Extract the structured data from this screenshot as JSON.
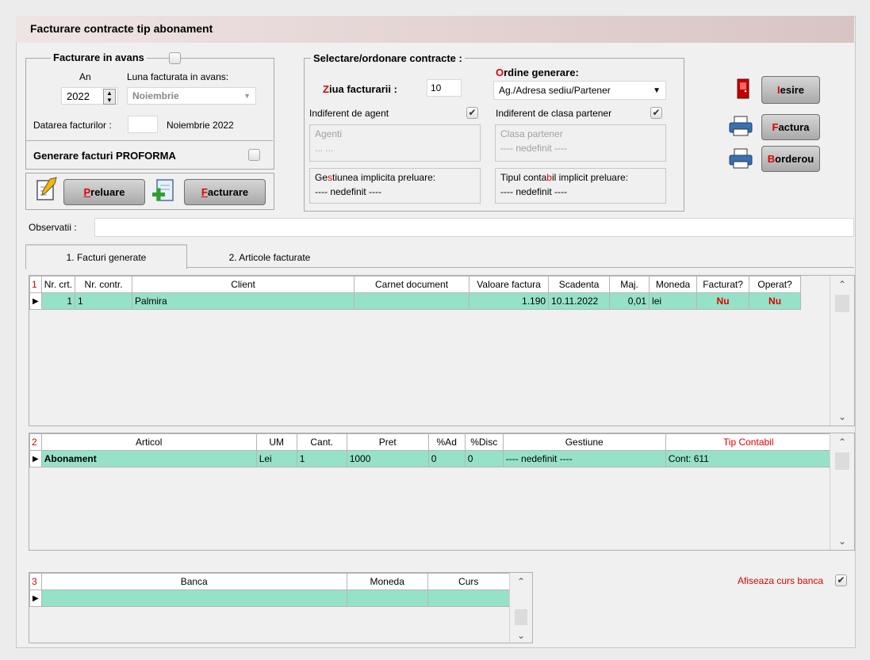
{
  "window": {
    "title": "Facturare contracte tip abonament"
  },
  "avans": {
    "group_label": "Facturare in avans",
    "an_label": "An",
    "an_value": "2022",
    "luna_label": "Luna facturata in avans:",
    "luna_value": "Noiembrie",
    "datarea_label": "Datarea facturilor :",
    "datarea_value": "Noiembrie 2022",
    "proforma_label": "Generare facturi PROFORMA"
  },
  "actions": {
    "preluare_first": "P",
    "preluare_rest": "reluare",
    "facturare_first": "F",
    "facturare_rest": "acturare"
  },
  "selectare": {
    "group_label": "Selectare/ordonare contracte :",
    "ziua_first": "Z",
    "ziua_rest": "iua facturarii :",
    "ziua_value": "10",
    "ordine_first": "O",
    "ordine_rest": "rdine generare:",
    "ordine_value": "Ag./Adresa sediu/Partener",
    "indif_agent": "Indiferent de agent",
    "indif_clasa": "Indiferent de clasa partener",
    "agenti_label": "Agenti",
    "agenti_value": "... ...",
    "clasa_label": "Clasa partener",
    "clasa_value": "---- nedefinit ----",
    "gest_label_pre": "Ge",
    "gest_label_s": "s",
    "gest_label_post": "tiunea implicita preluare:",
    "gest_value": "---- nedefinit ----",
    "tip_label_pre": "Tipul conta",
    "tip_label_b": "b",
    "tip_label_post": "il implicit preluare:",
    "tip_value": "---- nedefinit ----"
  },
  "right_buttons": {
    "iesire_first": "I",
    "iesire_rest": "esire",
    "factura_first": "F",
    "factura_rest": "actura",
    "borderou_first": "B",
    "borderou_rest": "orderou"
  },
  "observatii": {
    "label": "Observatii :",
    "value": ""
  },
  "tabs": [
    {
      "label": "1. Facturi generate"
    },
    {
      "label": "2. Articole facturate"
    }
  ],
  "grid1": {
    "rownum": "1",
    "headers": [
      "Nr. crt.",
      "Nr. contr.",
      "Client",
      "Carnet document",
      "Valoare factura",
      "Scadenta",
      "Maj.",
      "Moneda",
      "Facturat?",
      "Operat?"
    ],
    "rows": [
      {
        "nr_crt": "1",
        "nr_contr": "1",
        "client": "Palmira",
        "carnet": "",
        "valoare": "1.190",
        "scadenta": "10.11.2022",
        "maj": "0,01",
        "moneda": "lei",
        "facturat": "Nu",
        "operat": "Nu"
      }
    ]
  },
  "grid2": {
    "rownum": "2",
    "headers": [
      "Articol",
      "UM",
      "Cant.",
      "Pret",
      "%Ad",
      "%Disc",
      "Gestiune",
      "Tip Contabil"
    ],
    "rows": [
      {
        "articol": "Abonament",
        "um": "Lei",
        "cant": "1",
        "pret": "1000",
        "ad": "0",
        "disc": "0",
        "gestiune": "---- nedefinit ----",
        "tip": "Cont: 611"
      }
    ]
  },
  "grid3": {
    "rownum": "3",
    "headers": [
      "Banca",
      "Moneda",
      "Curs"
    ]
  },
  "afiseaza": {
    "label": "Afiseaza curs banca"
  },
  "colors": {
    "grid_row": "#96e2c9",
    "accent_red": "#e00000",
    "title_bg": "#d9c4c4"
  }
}
